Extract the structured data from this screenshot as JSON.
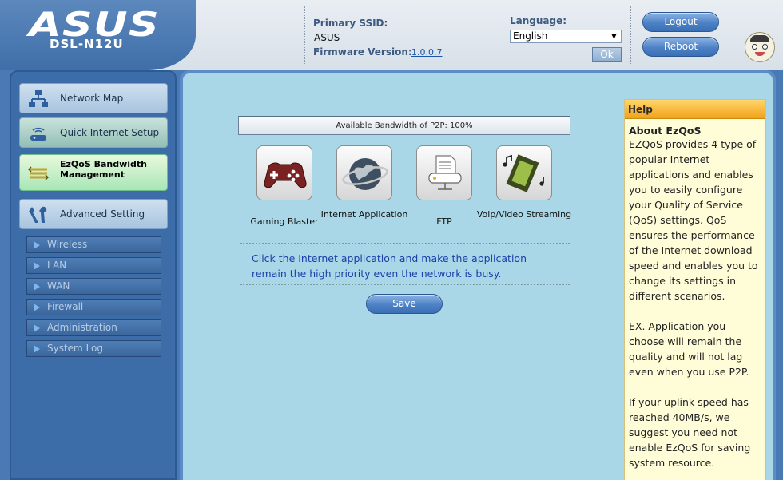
{
  "brand": {
    "logo": "ASUS",
    "model": "DSL-N12U"
  },
  "header": {
    "ssid_label": "Primary SSID:",
    "ssid_value": "ASUS",
    "firmware_label": "Firmware Version:",
    "firmware_value": "1.0.0.7",
    "language_label": "Language:",
    "language_value": "English",
    "ok_label": "Ok",
    "logout_label": "Logout",
    "reboot_label": "Reboot"
  },
  "sidebar": {
    "items": [
      {
        "label": "Network Map",
        "icon": "network-map-icon"
      },
      {
        "label": "Quick Internet Setup",
        "icon": "router-icon"
      },
      {
        "label": "EzQoS Bandwidth Management",
        "icon": "bandwidth-icon",
        "active": true
      },
      {
        "label": "Advanced Setting",
        "icon": "tools-icon"
      }
    ],
    "sub_items": [
      "Wireless",
      "LAN",
      "WAN",
      "Firewall",
      "Administration",
      "System Log"
    ]
  },
  "main": {
    "bandwidth_text": "Available Bandwidth of P2P: 100%",
    "apps": [
      {
        "label": "Gaming Blaster",
        "icon": "gamepad-icon"
      },
      {
        "label": "Internet Application",
        "icon": "globe-icon"
      },
      {
        "label": "FTP",
        "icon": "ftp-icon"
      },
      {
        "label": "Voip/Video Streaming",
        "icon": "film-music-icon"
      }
    ],
    "description": "Click the Internet application and make the application remain the high priority even the network is busy.",
    "save_label": "Save"
  },
  "help": {
    "header": "Help",
    "title": "About EzQoS",
    "paragraphs": [
      "EZQoS provides 4 type of popular Internet applications and enables you to easily configure your Quality of Service (QoS) settings. QoS ensures the performance of the Internet download speed and enables you to change its settings in different scenarios.",
      "EX. Application you choose will remain the quality and will not lag even when you use P2P.",
      "If your uplink speed has reached 40MB/s, we suggest you need not enable EzQoS for saving system resource."
    ]
  },
  "colors": {
    "accent_blue": "#4a7ab3",
    "main_panel": "#a9d7e7",
    "help_bg": "#fffdd8",
    "help_header": "#f1a21a",
    "description_text": "#1b3fa8"
  }
}
